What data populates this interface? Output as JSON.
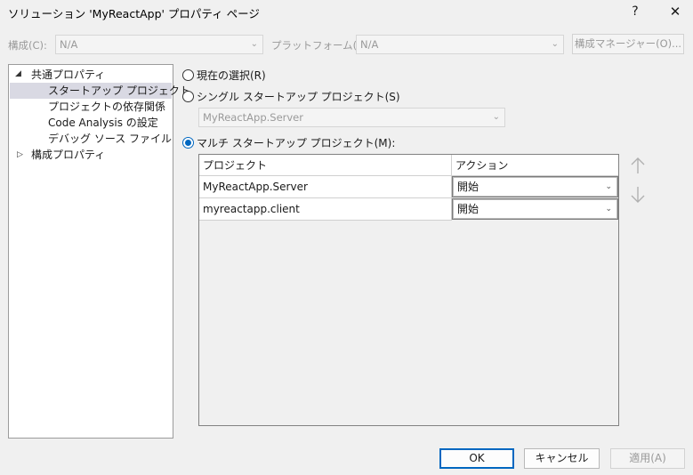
{
  "window": {
    "title": "ソリューション 'MyReactApp' プロパティ ページ",
    "help_label": "?",
    "close_label": "✕"
  },
  "config_row": {
    "config_label": "構成(C):",
    "config_value": "N/A",
    "platform_label": "プラットフォーム(P):",
    "platform_value": "N/A",
    "config_manager_label": "構成マネージャー(O)..."
  },
  "tree": {
    "common_props": "共通プロパティ",
    "items": [
      "スタートアップ プロジェクト",
      "プロジェクトの依存関係",
      "Code Analysis の設定",
      "デバッグ ソース ファイル"
    ],
    "config_props": "構成プロパティ",
    "selected_index": 0
  },
  "startup": {
    "current_selection_label": "現在の選択(R)",
    "single_label": "シングル スタートアップ プロジェクト(S)",
    "single_combo_value": "MyReactApp.Server",
    "multi_label": "マルチ スタートアップ プロジェクト(M):",
    "selected_option": "multi"
  },
  "grid": {
    "columns": [
      "プロジェクト",
      "アクション"
    ],
    "rows": [
      {
        "project": "MyReactApp.Server",
        "action": "開始"
      },
      {
        "project": "myreactapp.client",
        "action": "開始"
      }
    ]
  },
  "buttons": {
    "ok": "OK",
    "cancel": "キャンセル",
    "apply": "適用(A)"
  },
  "icons": {
    "move_up": "arrow-up-icon",
    "move_down": "arrow-down-icon"
  },
  "colors": {
    "accent": "#0067c0",
    "tree_selection": "#d9d9e3"
  }
}
